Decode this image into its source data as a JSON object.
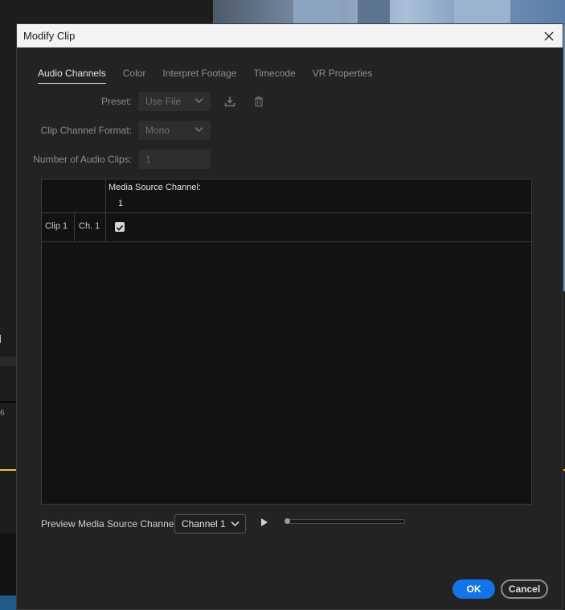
{
  "window": {
    "title": "Modify Clip"
  },
  "tabs": [
    {
      "label": "Audio Channels",
      "active": true
    },
    {
      "label": "Color",
      "active": false
    },
    {
      "label": "Interpret Footage",
      "active": false
    },
    {
      "label": "Timecode",
      "active": false
    },
    {
      "label": "VR Properties",
      "active": false
    }
  ],
  "form": {
    "preset_label": "Preset:",
    "preset_value": "Use File",
    "format_label": "Clip Channel Format:",
    "format_value": "Mono",
    "num_clips_label": "Number of Audio Clips:",
    "num_clips_value": "1"
  },
  "grid": {
    "column_title": "Media Source Channel:",
    "channel_numbers": [
      "1"
    ],
    "rows": [
      {
        "clip": "Clip 1",
        "channel": "Ch. 1",
        "checked": true
      }
    ]
  },
  "preview": {
    "label": "Preview Media Source Channel:",
    "channel_value": "Channel 1",
    "progress": 0
  },
  "buttons": {
    "ok": "OK",
    "cancel": "Cancel"
  },
  "background": {
    "left_text": "6"
  },
  "colors": {
    "accent": "#1473e6",
    "dialog_bg": "#232323",
    "grid_bg": "#121212"
  }
}
